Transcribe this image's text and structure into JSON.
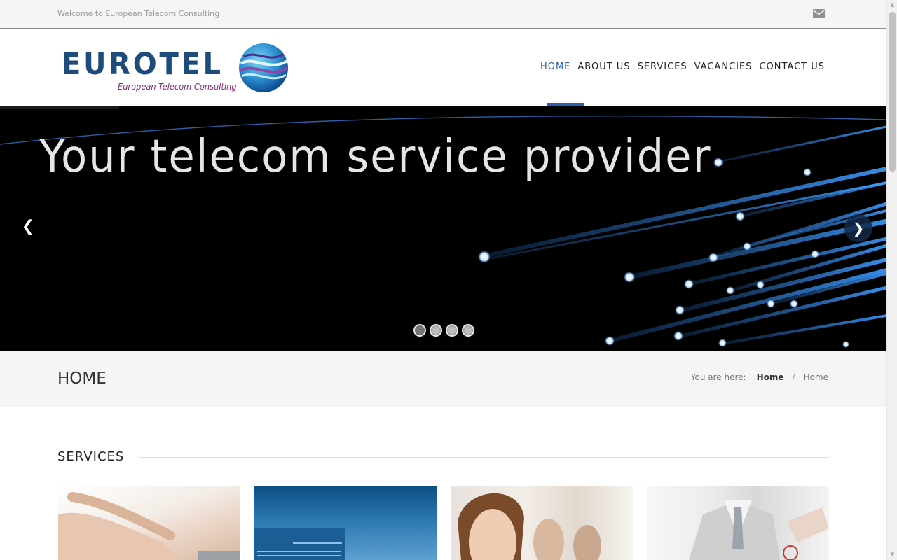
{
  "topbar": {
    "welcome": "Welcome to European Telecom Consulting",
    "mail_icon": "envelope-icon"
  },
  "logo": {
    "word": "EUROTEL",
    "tagline": "European Telecom Consulting"
  },
  "nav": {
    "items": [
      "HOME",
      "ABOUT US",
      "SERVICES",
      "VACANCIES",
      "CONTACT US"
    ],
    "active": "HOME"
  },
  "slider": {
    "headline": "Your telecom service provider",
    "prev_icon": "chevron-left-icon",
    "next_icon": "chevron-right-icon",
    "slides": 4,
    "active_slide": 1
  },
  "page_title": "HOME",
  "breadcrumb": {
    "prefix": "You are here:",
    "items": [
      "Home",
      "Home"
    ]
  },
  "services": {
    "title": "SERVICES"
  },
  "colors": {
    "accent": "#2b5fae",
    "logo_blue": "#1c4b7c",
    "tagline": "#8a2a7a",
    "titlebar_bg": "#f5f5f5"
  }
}
